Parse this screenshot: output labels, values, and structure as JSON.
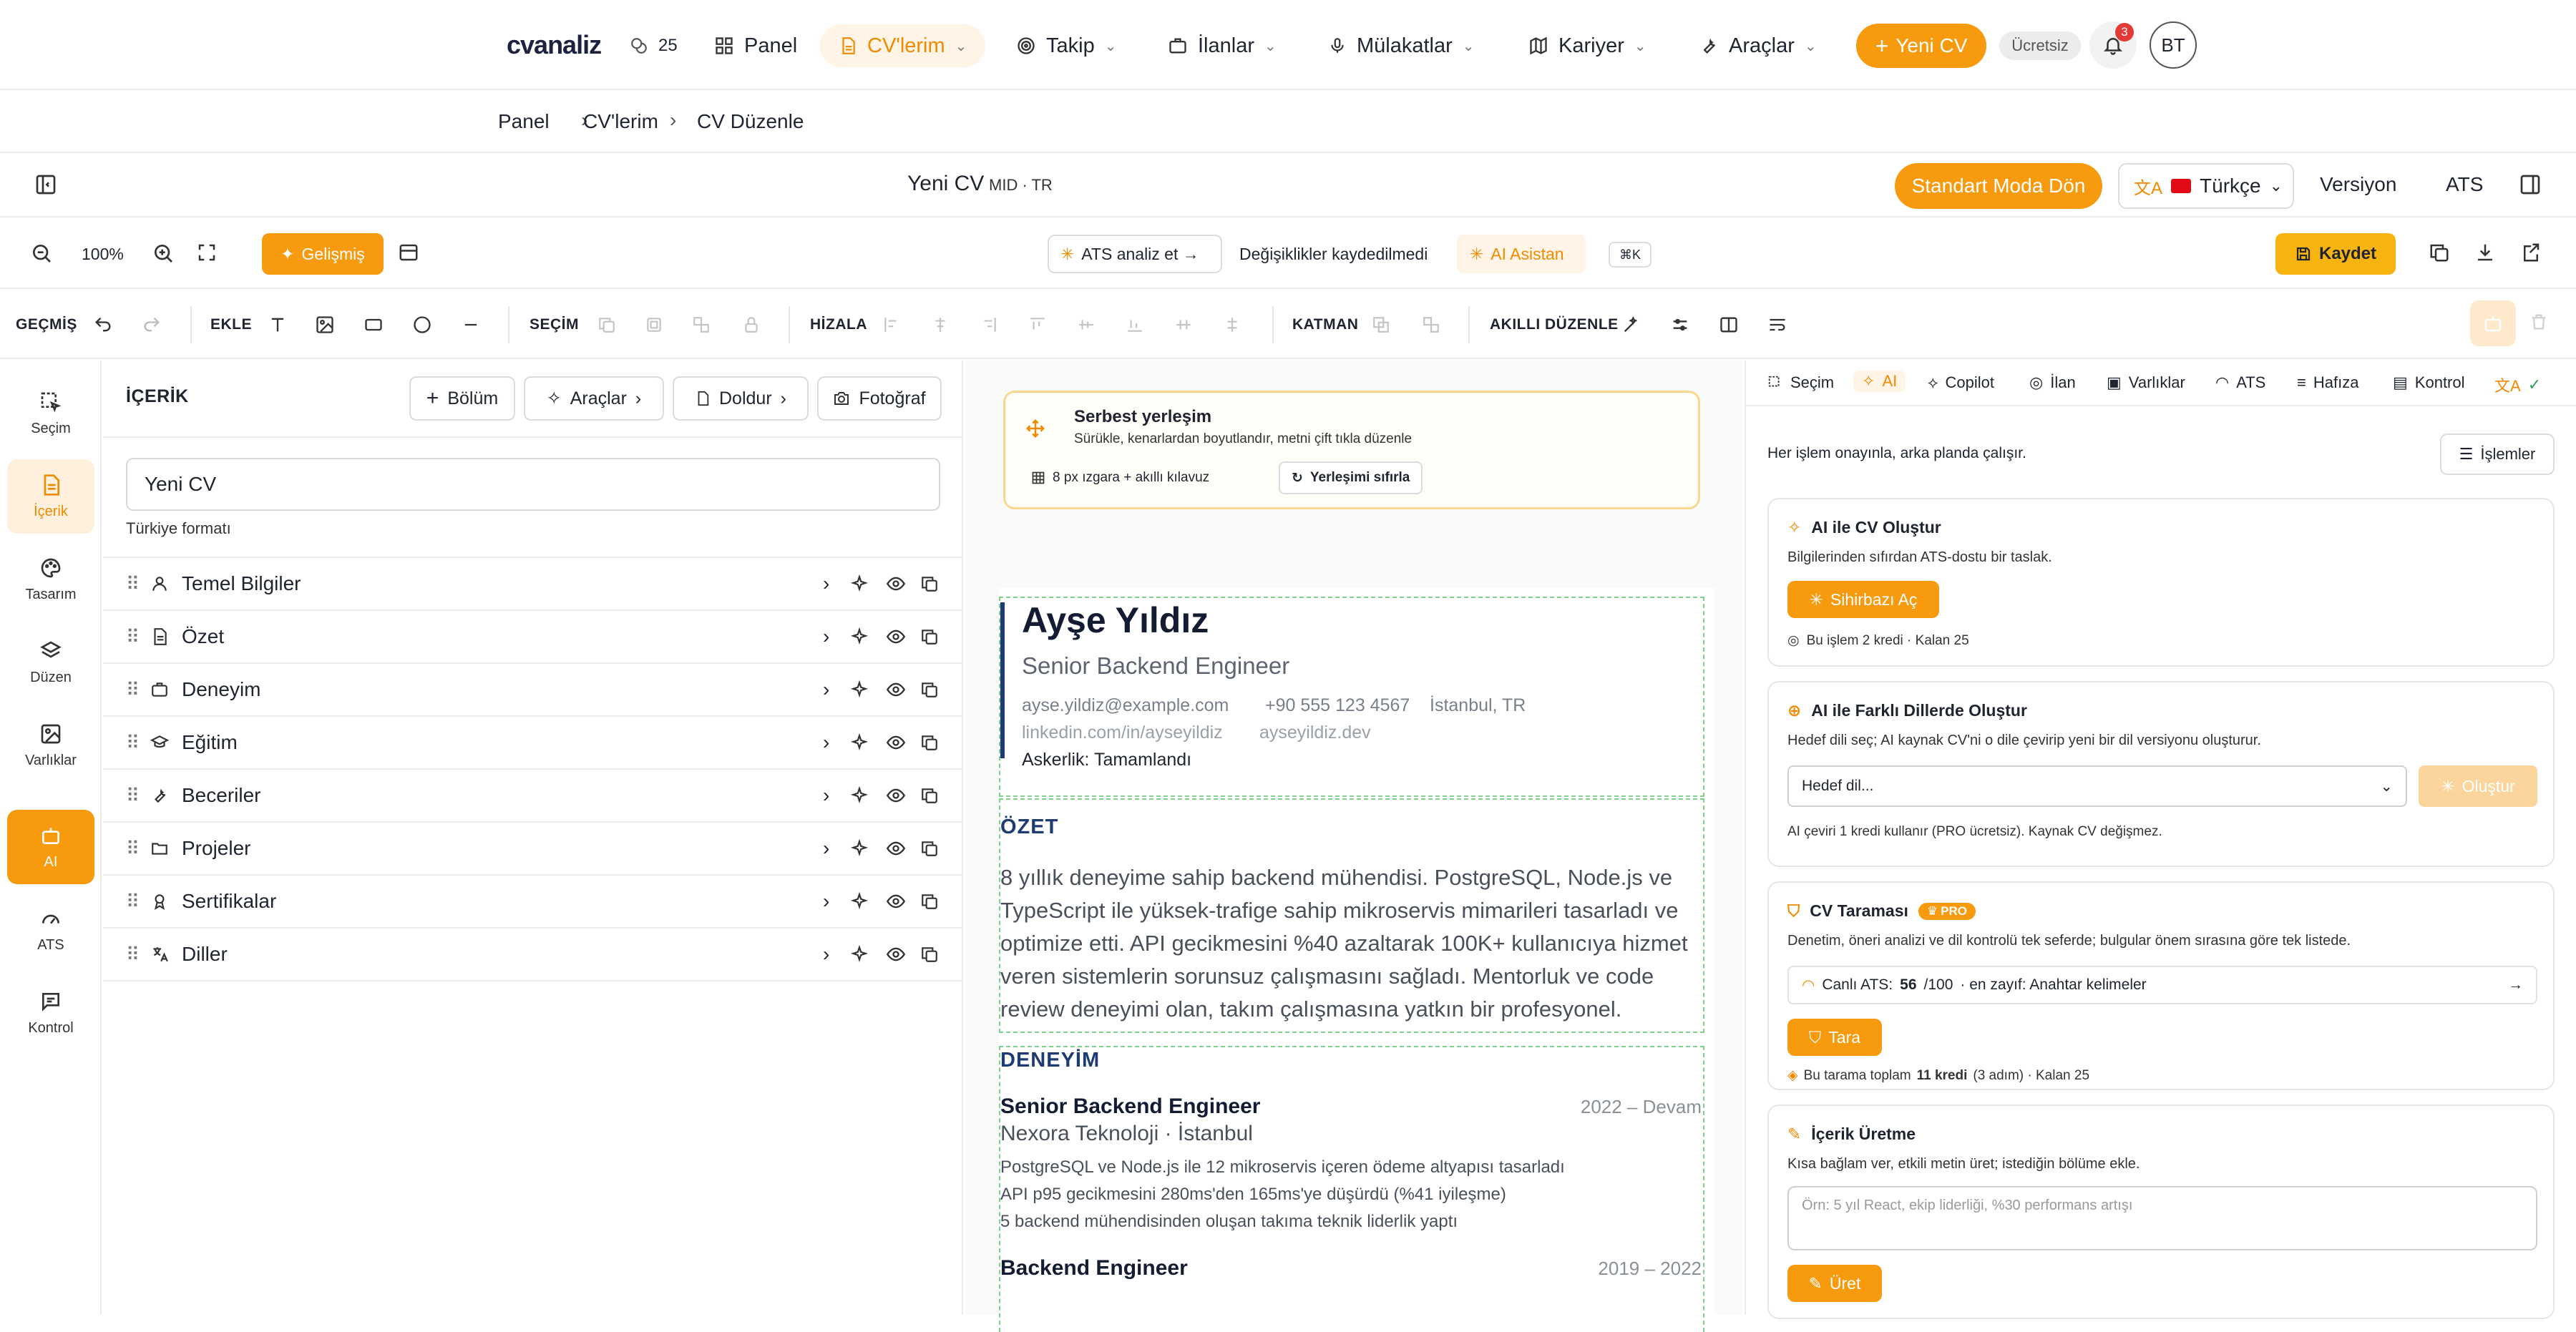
{
  "nav": {
    "logo": "cvanaliz",
    "credits": "25",
    "items": [
      {
        "label": "Panel"
      },
      {
        "label": "CV'lerim"
      },
      {
        "label": "Takip"
      },
      {
        "label": "İlanlar"
      },
      {
        "label": "Mülakatlar"
      },
      {
        "label": "Kariyer"
      },
      {
        "label": "Araçlar"
      }
    ],
    "new_cv": "Yeni CV",
    "plan": "Ücretsiz",
    "notifications": "3",
    "avatar": "BT",
    "accent": "#f89a0e"
  },
  "breadcrumb": [
    "Panel",
    "CV'lerim",
    "CV Düzenle"
  ],
  "editor": {
    "title": "Yeni CV",
    "meta": "MID · TR",
    "standard_mode": "Standart Moda Dön",
    "language": "Türkçe",
    "version": "Versiyon",
    "ats": "ATS"
  },
  "toolbar": {
    "zoom": "100%",
    "advanced": "Gelişmiş",
    "ats_analyze": "ATS  analiz et →",
    "unsaved": "Değişiklikler kaydedilmedi",
    "ai_assistant": "AI Asistan",
    "shortcut": "⌘K",
    "save": "Kaydet"
  },
  "toolbar2": {
    "history": "GEÇMİŞ",
    "add": "EKLE",
    "select": "SEÇİM",
    "align": "HİZALA",
    "layer": "KATMAN",
    "smart": "AKILLI DÜZENLE"
  },
  "rail": [
    {
      "label": "Seçim",
      "icon": "cursor-select-icon"
    },
    {
      "label": "İçerik",
      "icon": "document-icon"
    },
    {
      "label": "Tasarım",
      "icon": "palette-icon"
    },
    {
      "label": "Düzen",
      "icon": "layers-icon"
    },
    {
      "label": "Varlıklar",
      "icon": "image-icon"
    },
    {
      "label": "AI",
      "icon": "robot-icon"
    },
    {
      "label": "ATS",
      "icon": "gauge-icon"
    },
    {
      "label": "Kontrol",
      "icon": "message-icon"
    }
  ],
  "content": {
    "title": "İÇERİK",
    "btn_section": "Bölüm",
    "btn_tools": "Araçlar",
    "btn_fill": "Doldur",
    "btn_photo": "Fotoğraf",
    "cv_name": "Yeni CV",
    "format": "Türkiye formatı",
    "sections": [
      {
        "label": "Temel Bilgiler",
        "icon": "user-icon"
      },
      {
        "label": "Özet",
        "icon": "file-text-icon"
      },
      {
        "label": "Deneyim",
        "icon": "briefcase-icon"
      },
      {
        "label": "Eğitim",
        "icon": "graduation-cap-icon"
      },
      {
        "label": "Beceriler",
        "icon": "wrench-icon"
      },
      {
        "label": "Projeler",
        "icon": "folder-icon"
      },
      {
        "label": "Sertifikalar",
        "icon": "award-icon"
      },
      {
        "label": "Diller",
        "icon": "translate-icon"
      }
    ]
  },
  "canvas": {
    "hint_title": "Serbest yerleşim",
    "hint_sub": "Sürükle, kenarlardan boyutlandır, metni çift tıkla düzenle",
    "grid": "8 px ızgara + akıllı kılavuz",
    "reset": "Yerleşimi sıfırla"
  },
  "cv": {
    "name": "Ayşe Yıldız",
    "role": "Senior Backend Engineer",
    "email": "ayse.yildiz@example.com",
    "phone": "+90 555 123 4567",
    "location": "İstanbul, TR",
    "linkedin": "linkedin.com/in/ayseyildiz",
    "website": "ayseyildiz.dev",
    "military": "Askerlik: Tamamlandı",
    "summary_title": "ÖZET",
    "summary": "8 yıllık deneyime sahip backend mühendisi. PostgreSQL, Node.js ve TypeScript ile yüksek-trafige sahip mikroservis mimarileri tasarladı ve optimize etti. API gecikmesini %40 azaltarak 100K+ kullanıcıya hizmet veren sistemlerin sorunsuz çalışmasını sağladı. Mentorluk ve code review deneyimi olan, takım çalışmasına yatkın bir profesyonel.",
    "experience_title": "DENEYİM",
    "jobs": [
      {
        "title": "Senior Backend Engineer",
        "dates": "2022 – Devam",
        "company": "Nexora Teknoloji · İstanbul",
        "bullets": [
          "PostgreSQL ve Node.js ile 12 mikroservis içeren ödeme altyapısı tasarladı",
          "API p95 gecikmesini 280ms'den 165ms'ye düşürdü (%41 iyileşme)",
          "5 backend mühendisinden oluşan takıma teknik liderlik yaptı"
        ]
      },
      {
        "title": "Backend Engineer",
        "dates": "2019 – 2022"
      }
    ]
  },
  "right": {
    "tabs": [
      "Seçim",
      "AI",
      "Copilot",
      "İlan",
      "Varlıklar",
      "ATS",
      "Hafıza",
      "Kontrol"
    ],
    "intro": "Her işlem onayınla, arka planda çalışır.",
    "ops": "İşlemler",
    "card1": {
      "title": "AI ile CV Oluştur",
      "sub": "Bilgilerinden sıfırdan ATS-dostu bir taslak.",
      "btn": "Sihirbazı Aç",
      "note": "Bu işlem 2 kredi · Kalan 25"
    },
    "card2": {
      "title": "AI ile Farklı Dillerde Oluştur",
      "sub": "Hedef dili seç; AI kaynak CV'ni o dile çevirip yeni bir dil versiyonu oluşturur.",
      "select": "Hedef dil...",
      "btn": "Oluştur",
      "note": "AI çeviri 1 kredi kullanır (PRO ücretsiz). Kaynak CV değişmez."
    },
    "card3": {
      "title": "CV Taraması",
      "badge": "PRO",
      "sub": "Denetim, öneri analizi ve dil kontrolü tek seferde; bulgular önem sırasına göre tek listede.",
      "live_label": "Canlı ATS:",
      "score": "56",
      "max": "/100",
      "weakest": "· en zayıf: Anahtar kelimeler",
      "btn": "Tara",
      "note_pre": "Bu tarama toplam",
      "note_credits": "11 kredi",
      "note_post": "(3 adım)  · Kalan 25"
    },
    "card4": {
      "title": "İçerik Üretme",
      "sub": "Kısa bağlam ver, etkili metin üret; istediğin bölüme ekle.",
      "placeholder": "Örn: 5 yıl React, ekip liderliği, %30 performans artışı",
      "btn": "Üret"
    }
  }
}
